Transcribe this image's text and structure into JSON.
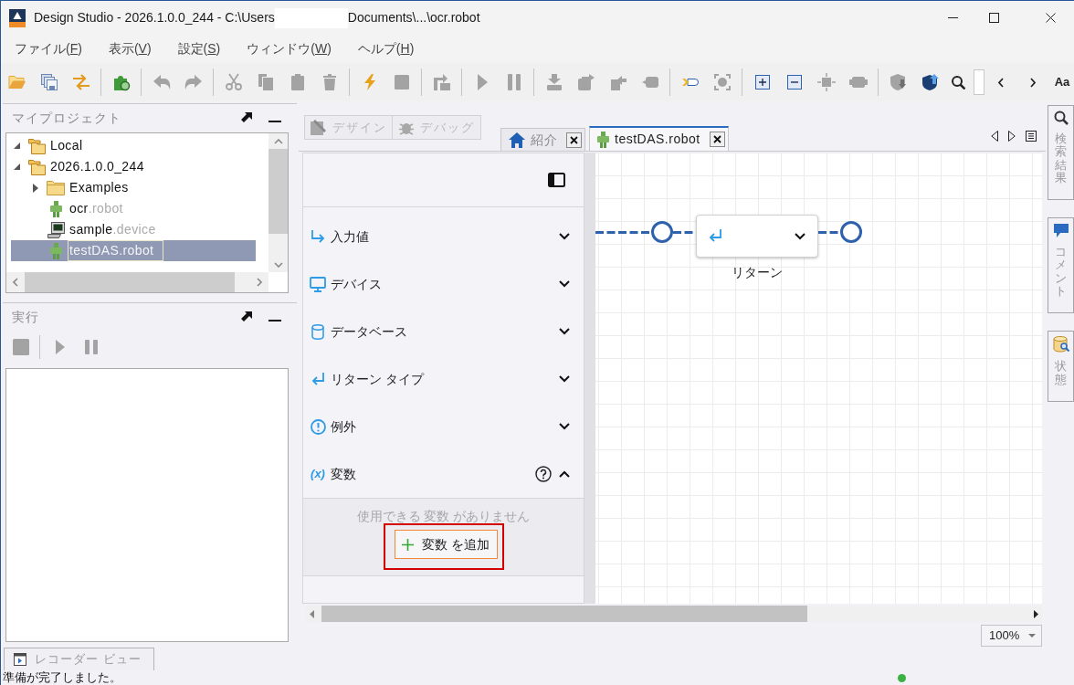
{
  "window": {
    "title_before_redaction": "Design Studio - 2026.1.0.0_244 - C:\\Users",
    "path_redacted": true,
    "title_after_redaction": "Documents\\...\\ocr.robot"
  },
  "menu": [
    {
      "before": "ファイル(",
      "mnemonic": "F",
      "after": ")"
    },
    {
      "before": "表示(",
      "mnemonic": "V",
      "after": ")"
    },
    {
      "before": "設定(",
      "mnemonic": "S",
      "after": ")"
    },
    {
      "before": "ウィンドウ(",
      "mnemonic": "W",
      "after": ")"
    },
    {
      "before": "ヘルプ(",
      "mnemonic": "H",
      "after": ")"
    }
  ],
  "toolbar": {
    "groups": [
      [
        {
          "kind": "open",
          "disabled": false
        },
        {
          "kind": "save_all",
          "disabled": false
        },
        {
          "kind": "swap",
          "disabled": false
        }
      ],
      [
        {
          "kind": "add_robot",
          "disabled": false
        }
      ],
      [
        {
          "kind": "undo",
          "disabled": true
        },
        {
          "kind": "redo",
          "disabled": true
        }
      ],
      [
        {
          "kind": "cut",
          "disabled": true
        },
        {
          "kind": "copy",
          "disabled": true
        },
        {
          "kind": "paste",
          "disabled": true
        },
        {
          "kind": "delete",
          "disabled": true
        }
      ],
      [
        {
          "kind": "run",
          "disabled": false
        },
        {
          "kind": "stop",
          "disabled": true
        }
      ],
      [
        {
          "kind": "loop",
          "disabled": true
        }
      ],
      [
        {
          "kind": "play",
          "disabled": true
        },
        {
          "kind": "pause",
          "disabled": true
        }
      ],
      [
        {
          "kind": "step_into",
          "disabled": true
        },
        {
          "kind": "step_over",
          "disabled": true
        },
        {
          "kind": "step_out",
          "disabled": true
        },
        {
          "kind": "step_back",
          "disabled": true
        }
      ],
      [
        {
          "kind": "tag",
          "disabled": false
        },
        {
          "kind": "focus",
          "disabled": true
        }
      ],
      [
        {
          "kind": "expand",
          "disabled": false
        },
        {
          "kind": "collapse",
          "disabled": false
        },
        {
          "kind": "center",
          "disabled": true
        },
        {
          "kind": "plugin",
          "disabled": true
        }
      ],
      [
        {
          "kind": "shield_down",
          "disabled": true
        },
        {
          "kind": "shield_up",
          "disabled": false
        },
        {
          "kind": "search",
          "disabled": false
        },
        {
          "kind": "search_field",
          "disabled": false
        },
        {
          "kind": "prev",
          "disabled": false
        },
        {
          "kind": "next",
          "disabled": false
        },
        {
          "kind": "text_button",
          "label": "Aa",
          "disabled": false
        }
      ]
    ]
  },
  "project_panel": {
    "title": "マイプロジェクト",
    "tree": [
      {
        "kind": "folders",
        "name": "Local",
        "expanded": true,
        "selected": false
      },
      {
        "kind": "folders",
        "name": "2026.1.0.0_244",
        "expanded": true,
        "selected": false,
        "children": [
          {
            "kind": "folder",
            "name": "Examples",
            "expanded": false,
            "selected": false
          },
          {
            "kind": "robot",
            "name": "ocr",
            "extension": ".robot",
            "selected": false
          },
          {
            "kind": "device",
            "name": "sample",
            "extension": ".device",
            "selected": false
          },
          {
            "kind": "robot",
            "name": "testDAS",
            "extension": ".robot",
            "selected": true
          }
        ]
      }
    ]
  },
  "run_panel": {
    "title": "実行",
    "control_groups": [
      [
        {
          "kind": "stop",
          "disabled": true
        }
      ],
      [
        {
          "kind": "play",
          "disabled": true
        },
        {
          "kind": "pause",
          "disabled": true
        }
      ]
    ]
  },
  "bottom_tab": {
    "label": "レコーダー ビュー"
  },
  "mode_buttons": [
    {
      "kind": "design",
      "label": "デザイン",
      "disabled": true
    },
    {
      "kind": "debug",
      "label": "デバッグ",
      "disabled": true
    }
  ],
  "editor_tabs": [
    {
      "kind": "home",
      "label": "紹介",
      "selected": false
    },
    {
      "kind": "robot",
      "label": "testDAS.robot",
      "selected": true
    }
  ],
  "properties": {
    "sections": [
      {
        "kind": "input",
        "label": "入力値",
        "expanded": false
      },
      {
        "kind": "device",
        "label": "デバイス",
        "expanded": false
      },
      {
        "kind": "database",
        "label": "データベース",
        "expanded": false
      },
      {
        "kind": "return_type",
        "label": "リターン タイプ",
        "expanded": false
      },
      {
        "kind": "exception",
        "label": "例外",
        "expanded": false
      },
      {
        "kind": "variables",
        "symbol": "(x)",
        "label": "変数",
        "expanded": true,
        "empty_message": "使用できる 変数 がありません",
        "add_button": {
          "label": "変数 を追加",
          "highlighted": true
        }
      }
    ]
  },
  "flow": {
    "nodes": [
      {
        "kind": "return",
        "label": "リターン"
      }
    ]
  },
  "zoom": {
    "value": "100%"
  },
  "side_tabs": [
    {
      "kind": "search",
      "label": "検索結果"
    },
    {
      "kind": "comment",
      "label": "コメント"
    },
    {
      "kind": "state",
      "label": "状態"
    }
  ],
  "status_bar": {
    "message": "準備が完了しました。"
  }
}
